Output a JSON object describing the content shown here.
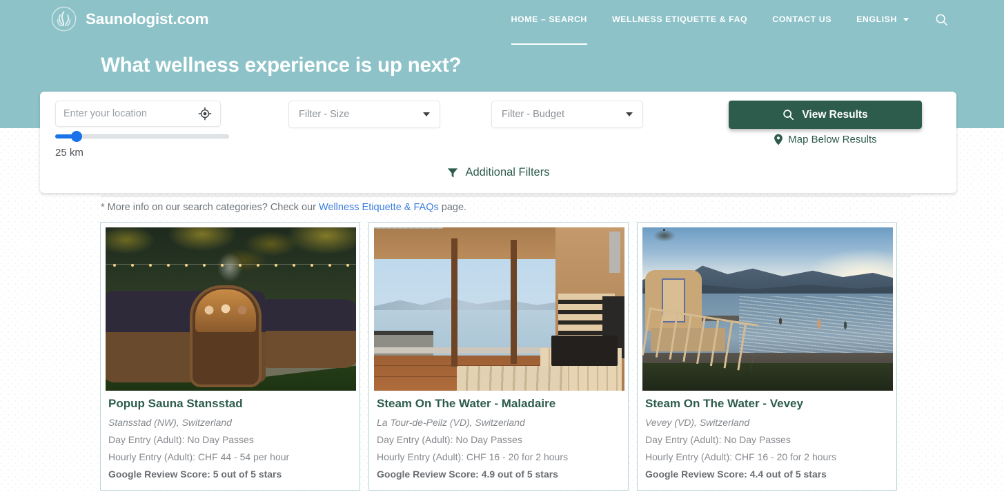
{
  "header": {
    "brand": "Saunologist.com",
    "logo_icon": "sauna-leaf-logo-icon",
    "nav": [
      {
        "label": "HOME – SEARCH",
        "active": true
      },
      {
        "label": "WELLNESS ETIQUETTE & FAQ",
        "active": false
      },
      {
        "label": "CONTACT US",
        "active": false
      },
      {
        "label": "ENGLISH",
        "active": false,
        "caret": true
      }
    ],
    "search_icon": "search-icon",
    "headline": "What wellness experience is up next?"
  },
  "search": {
    "location_placeholder": "Enter your location",
    "location_value": "",
    "locate_icon": "my-location-icon",
    "distance_value": "25 km",
    "distance_number": 25,
    "distance_min": 0,
    "distance_max": 160,
    "size_filter": "Filter - Size",
    "budget_filter": "Filter - Budget",
    "view_results_label": "View Results",
    "view_results_icon": "search-icon",
    "map_below_label": "Map Below Results",
    "map_pin_icon": "map-pin-icon",
    "additional_filters_label": "Additional Filters",
    "filter_icon": "funnel-icon",
    "accent_color": "#2d5c4d",
    "header_color": "#8cc2c8",
    "slider_color": "#1a73e8"
  },
  "note": {
    "prefix": "* More info on our search categories? Check our ",
    "link": "Wellness Etiquette & FAQs",
    "suffix": " page."
  },
  "results": [
    {
      "title": "Popup Sauna Stansstad",
      "location": "Stansstad (NW), Switzerland",
      "day_entry": "Day Entry (Adult): No Day Passes",
      "hourly_entry": "Hourly Entry (Adult): CHF 44 - 54 per hour",
      "review": "Google Review Score: 5 out of 5 stars",
      "photo": "popup-sauna-barrels-at-dusk"
    },
    {
      "title": "Steam On The Water - Maladaire",
      "location": "La Tour-de-Peilz (VD), Switzerland",
      "day_entry": "Day Entry (Adult): No Day Passes",
      "hourly_entry": "Hourly Entry (Adult): CHF 16 - 20 for 2 hours",
      "review": "Google Review Score: 4.9 out of 5 stars",
      "photo": "sauna-interior-lake-view"
    },
    {
      "title": "Steam On The Water - Vevey",
      "location": "Vevey (VD), Switzerland",
      "day_entry": "Day Entry (Adult): No Day Passes",
      "hourly_entry": "Hourly Entry (Adult): CHF 16 - 20 for 2 hours",
      "review": "Google Review Score: 4.4 out of 5 stars",
      "photo": "lakeside-sauna-sunset-swimmers"
    }
  ]
}
